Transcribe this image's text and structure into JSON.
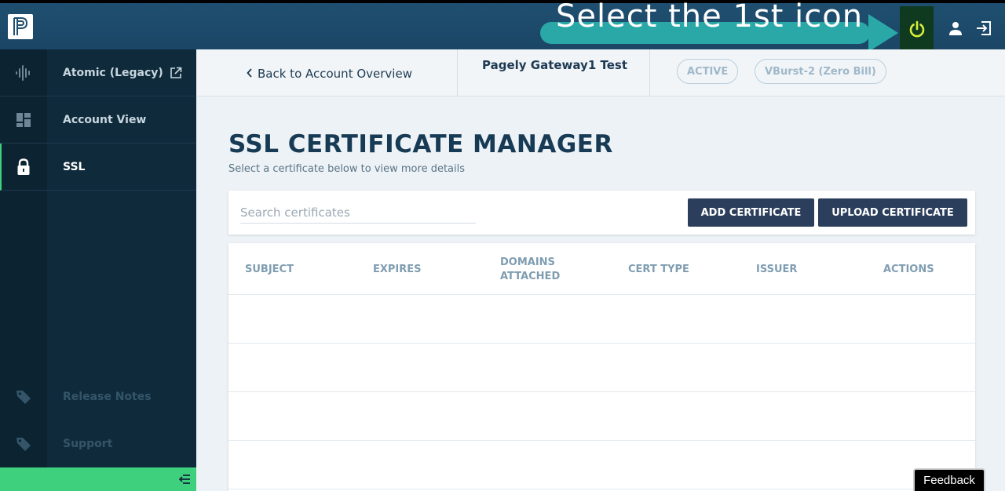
{
  "topbar": {
    "logo_letter": "P",
    "tooltip_text": "Select the 1st icon",
    "icons": [
      "power-icon",
      "user-icon",
      "logout-icon"
    ]
  },
  "sidebar": {
    "items": [
      {
        "label": "Atomic (Legacy)",
        "icon": "waveform-icon"
      },
      {
        "label": "Account View",
        "icon": "grid-icon"
      },
      {
        "label": "SSL",
        "icon": "lock-icon"
      }
    ],
    "bottom_items": [
      {
        "label": "Release Notes",
        "icon": "tag-icon"
      },
      {
        "label": "Support",
        "icon": "tag-icon"
      }
    ]
  },
  "header": {
    "back_label": "Back to Account Overview",
    "account_name": "Pagely Gateway1 Test",
    "status_pill": "ACTIVE",
    "plan_pill": "VBurst-2 (Zero Bill)"
  },
  "main": {
    "title": "SSL CERTIFICATE MANAGER",
    "subtitle": "Select a certificate below to view more details",
    "search_placeholder": "Search certificates",
    "add_button": "ADD CERTIFICATE",
    "upload_button": "UPLOAD CERTIFICATE",
    "columns": [
      "SUBJECT",
      "EXPIRES",
      "DOMAINS ATTACHED",
      "CERT TYPE",
      "ISSUER",
      "ACTIONS"
    ]
  },
  "feedback_label": "Feedback",
  "colors": {
    "topbar": "#1f4f70",
    "sidebar": "#0f2a3b",
    "accent_green": "#3fd07d",
    "button": "#2b3e5c",
    "tooltip": "#2aa8a8"
  }
}
